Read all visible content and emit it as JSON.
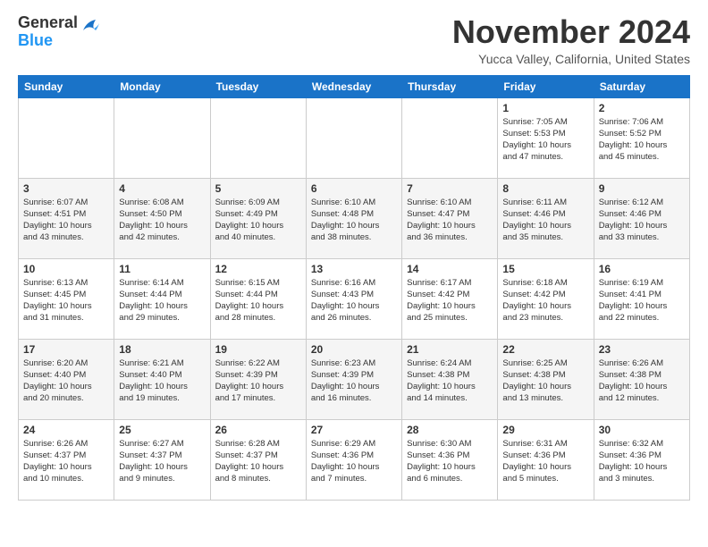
{
  "header": {
    "logo_line1": "General",
    "logo_line2": "Blue",
    "month": "November 2024",
    "location": "Yucca Valley, California, United States"
  },
  "weekdays": [
    "Sunday",
    "Monday",
    "Tuesday",
    "Wednesday",
    "Thursday",
    "Friday",
    "Saturday"
  ],
  "weeks": [
    [
      {
        "day": "",
        "info": ""
      },
      {
        "day": "",
        "info": ""
      },
      {
        "day": "",
        "info": ""
      },
      {
        "day": "",
        "info": ""
      },
      {
        "day": "",
        "info": ""
      },
      {
        "day": "1",
        "info": "Sunrise: 7:05 AM\nSunset: 5:53 PM\nDaylight: 10 hours\nand 47 minutes."
      },
      {
        "day": "2",
        "info": "Sunrise: 7:06 AM\nSunset: 5:52 PM\nDaylight: 10 hours\nand 45 minutes."
      }
    ],
    [
      {
        "day": "3",
        "info": "Sunrise: 6:07 AM\nSunset: 4:51 PM\nDaylight: 10 hours\nand 43 minutes."
      },
      {
        "day": "4",
        "info": "Sunrise: 6:08 AM\nSunset: 4:50 PM\nDaylight: 10 hours\nand 42 minutes."
      },
      {
        "day": "5",
        "info": "Sunrise: 6:09 AM\nSunset: 4:49 PM\nDaylight: 10 hours\nand 40 minutes."
      },
      {
        "day": "6",
        "info": "Sunrise: 6:10 AM\nSunset: 4:48 PM\nDaylight: 10 hours\nand 38 minutes."
      },
      {
        "day": "7",
        "info": "Sunrise: 6:10 AM\nSunset: 4:47 PM\nDaylight: 10 hours\nand 36 minutes."
      },
      {
        "day": "8",
        "info": "Sunrise: 6:11 AM\nSunset: 4:46 PM\nDaylight: 10 hours\nand 35 minutes."
      },
      {
        "day": "9",
        "info": "Sunrise: 6:12 AM\nSunset: 4:46 PM\nDaylight: 10 hours\nand 33 minutes."
      }
    ],
    [
      {
        "day": "10",
        "info": "Sunrise: 6:13 AM\nSunset: 4:45 PM\nDaylight: 10 hours\nand 31 minutes."
      },
      {
        "day": "11",
        "info": "Sunrise: 6:14 AM\nSunset: 4:44 PM\nDaylight: 10 hours\nand 29 minutes."
      },
      {
        "day": "12",
        "info": "Sunrise: 6:15 AM\nSunset: 4:44 PM\nDaylight: 10 hours\nand 28 minutes."
      },
      {
        "day": "13",
        "info": "Sunrise: 6:16 AM\nSunset: 4:43 PM\nDaylight: 10 hours\nand 26 minutes."
      },
      {
        "day": "14",
        "info": "Sunrise: 6:17 AM\nSunset: 4:42 PM\nDaylight: 10 hours\nand 25 minutes."
      },
      {
        "day": "15",
        "info": "Sunrise: 6:18 AM\nSunset: 4:42 PM\nDaylight: 10 hours\nand 23 minutes."
      },
      {
        "day": "16",
        "info": "Sunrise: 6:19 AM\nSunset: 4:41 PM\nDaylight: 10 hours\nand 22 minutes."
      }
    ],
    [
      {
        "day": "17",
        "info": "Sunrise: 6:20 AM\nSunset: 4:40 PM\nDaylight: 10 hours\nand 20 minutes."
      },
      {
        "day": "18",
        "info": "Sunrise: 6:21 AM\nSunset: 4:40 PM\nDaylight: 10 hours\nand 19 minutes."
      },
      {
        "day": "19",
        "info": "Sunrise: 6:22 AM\nSunset: 4:39 PM\nDaylight: 10 hours\nand 17 minutes."
      },
      {
        "day": "20",
        "info": "Sunrise: 6:23 AM\nSunset: 4:39 PM\nDaylight: 10 hours\nand 16 minutes."
      },
      {
        "day": "21",
        "info": "Sunrise: 6:24 AM\nSunset: 4:38 PM\nDaylight: 10 hours\nand 14 minutes."
      },
      {
        "day": "22",
        "info": "Sunrise: 6:25 AM\nSunset: 4:38 PM\nDaylight: 10 hours\nand 13 minutes."
      },
      {
        "day": "23",
        "info": "Sunrise: 6:26 AM\nSunset: 4:38 PM\nDaylight: 10 hours\nand 12 minutes."
      }
    ],
    [
      {
        "day": "24",
        "info": "Sunrise: 6:26 AM\nSunset: 4:37 PM\nDaylight: 10 hours\nand 10 minutes."
      },
      {
        "day": "25",
        "info": "Sunrise: 6:27 AM\nSunset: 4:37 PM\nDaylight: 10 hours\nand 9 minutes."
      },
      {
        "day": "26",
        "info": "Sunrise: 6:28 AM\nSunset: 4:37 PM\nDaylight: 10 hours\nand 8 minutes."
      },
      {
        "day": "27",
        "info": "Sunrise: 6:29 AM\nSunset: 4:36 PM\nDaylight: 10 hours\nand 7 minutes."
      },
      {
        "day": "28",
        "info": "Sunrise: 6:30 AM\nSunset: 4:36 PM\nDaylight: 10 hours\nand 6 minutes."
      },
      {
        "day": "29",
        "info": "Sunrise: 6:31 AM\nSunset: 4:36 PM\nDaylight: 10 hours\nand 5 minutes."
      },
      {
        "day": "30",
        "info": "Sunrise: 6:32 AM\nSunset: 4:36 PM\nDaylight: 10 hours\nand 3 minutes."
      }
    ]
  ]
}
